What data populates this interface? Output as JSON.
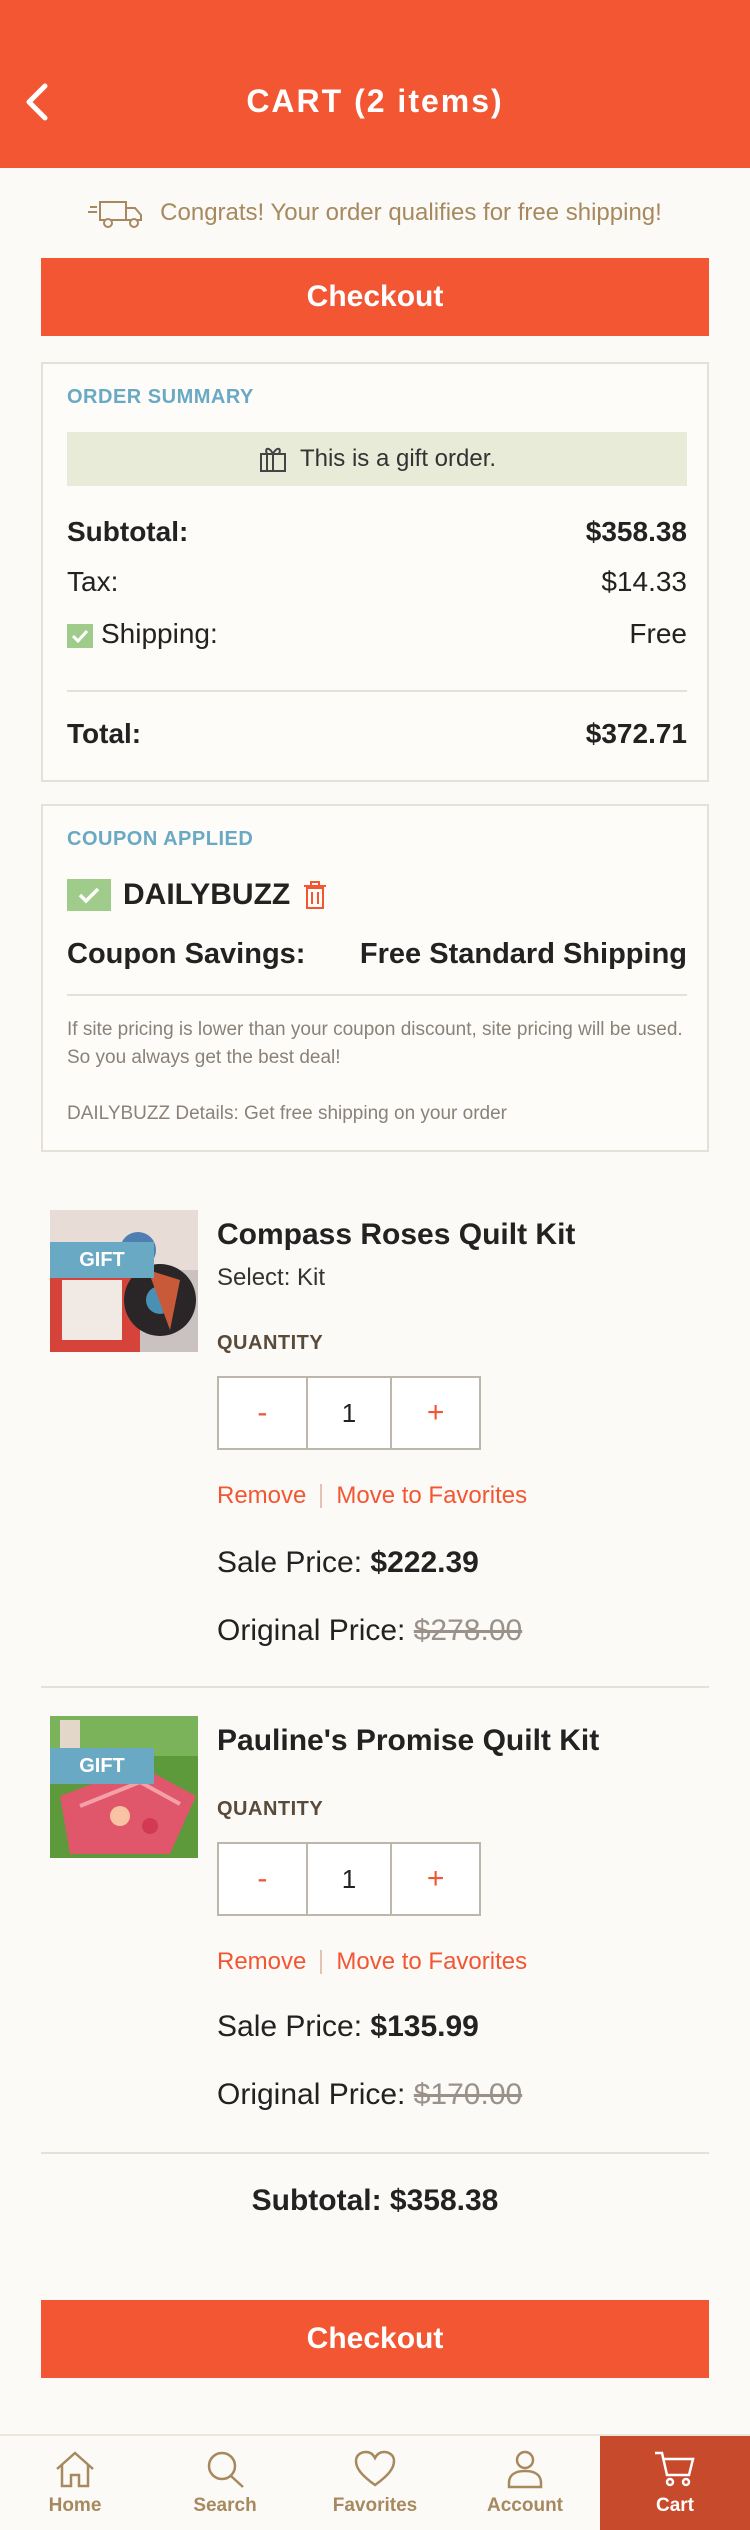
{
  "header": {
    "title": "CART (2 items)"
  },
  "free_shipping": {
    "message": "Congrats! Your order qualifies for free shipping!"
  },
  "checkout_label": "Checkout",
  "order_summary": {
    "label": "ORDER SUMMARY",
    "gift_note": "This is a gift order.",
    "subtotal_label": "Subtotal:",
    "subtotal_value": "$358.38",
    "tax_label": "Tax:",
    "tax_value": "$14.33",
    "shipping_label": "Shipping:",
    "shipping_value": "Free",
    "total_label": "Total:",
    "total_value": "$372.71"
  },
  "coupon": {
    "label": "COUPON APPLIED",
    "code": "DAILYBUZZ",
    "savings_label": "Coupon Savings:",
    "savings_value": "Free Standard Shipping",
    "note": "If site pricing is lower than your coupon discount, site pricing will be used. So you always get the best deal!",
    "details": "DAILYBUZZ Details: Get free shipping on your order"
  },
  "products": [
    {
      "badge": "GIFT",
      "name": "Compass Roses Quilt Kit",
      "select": "Select: Kit",
      "quantity_label": "QUANTITY",
      "quantity": "1",
      "minus": "-",
      "plus": "+",
      "remove": "Remove",
      "move": "Move to Favorites",
      "sale_label": "Sale Price:",
      "sale_value": "$222.39",
      "orig_label": "Original Price:",
      "orig_value": "$278.00"
    },
    {
      "badge": "GIFT",
      "name": "Pauline's Promise Quilt Kit",
      "quantity_label": "QUANTITY",
      "quantity": "1",
      "minus": "-",
      "plus": "+",
      "remove": "Remove",
      "move": "Move to Favorites",
      "sale_label": "Sale Price:",
      "sale_value": "$135.99",
      "orig_label": "Original Price:",
      "orig_value": "$170.00"
    }
  ],
  "cart_subtotal": "Subtotal: $358.38",
  "tabs": [
    {
      "label": "Home",
      "icon": "home-icon"
    },
    {
      "label": "Search",
      "icon": "search-icon"
    },
    {
      "label": "Favorites",
      "icon": "heart-icon"
    },
    {
      "label": "Account",
      "icon": "person-icon"
    },
    {
      "label": "Cart",
      "icon": "cart-icon"
    }
  ],
  "colors": {
    "brand": "#f25633",
    "accent_blue": "#6aa9c4",
    "check_green": "#9fcc8a",
    "active_tab": "#c84a2d"
  }
}
